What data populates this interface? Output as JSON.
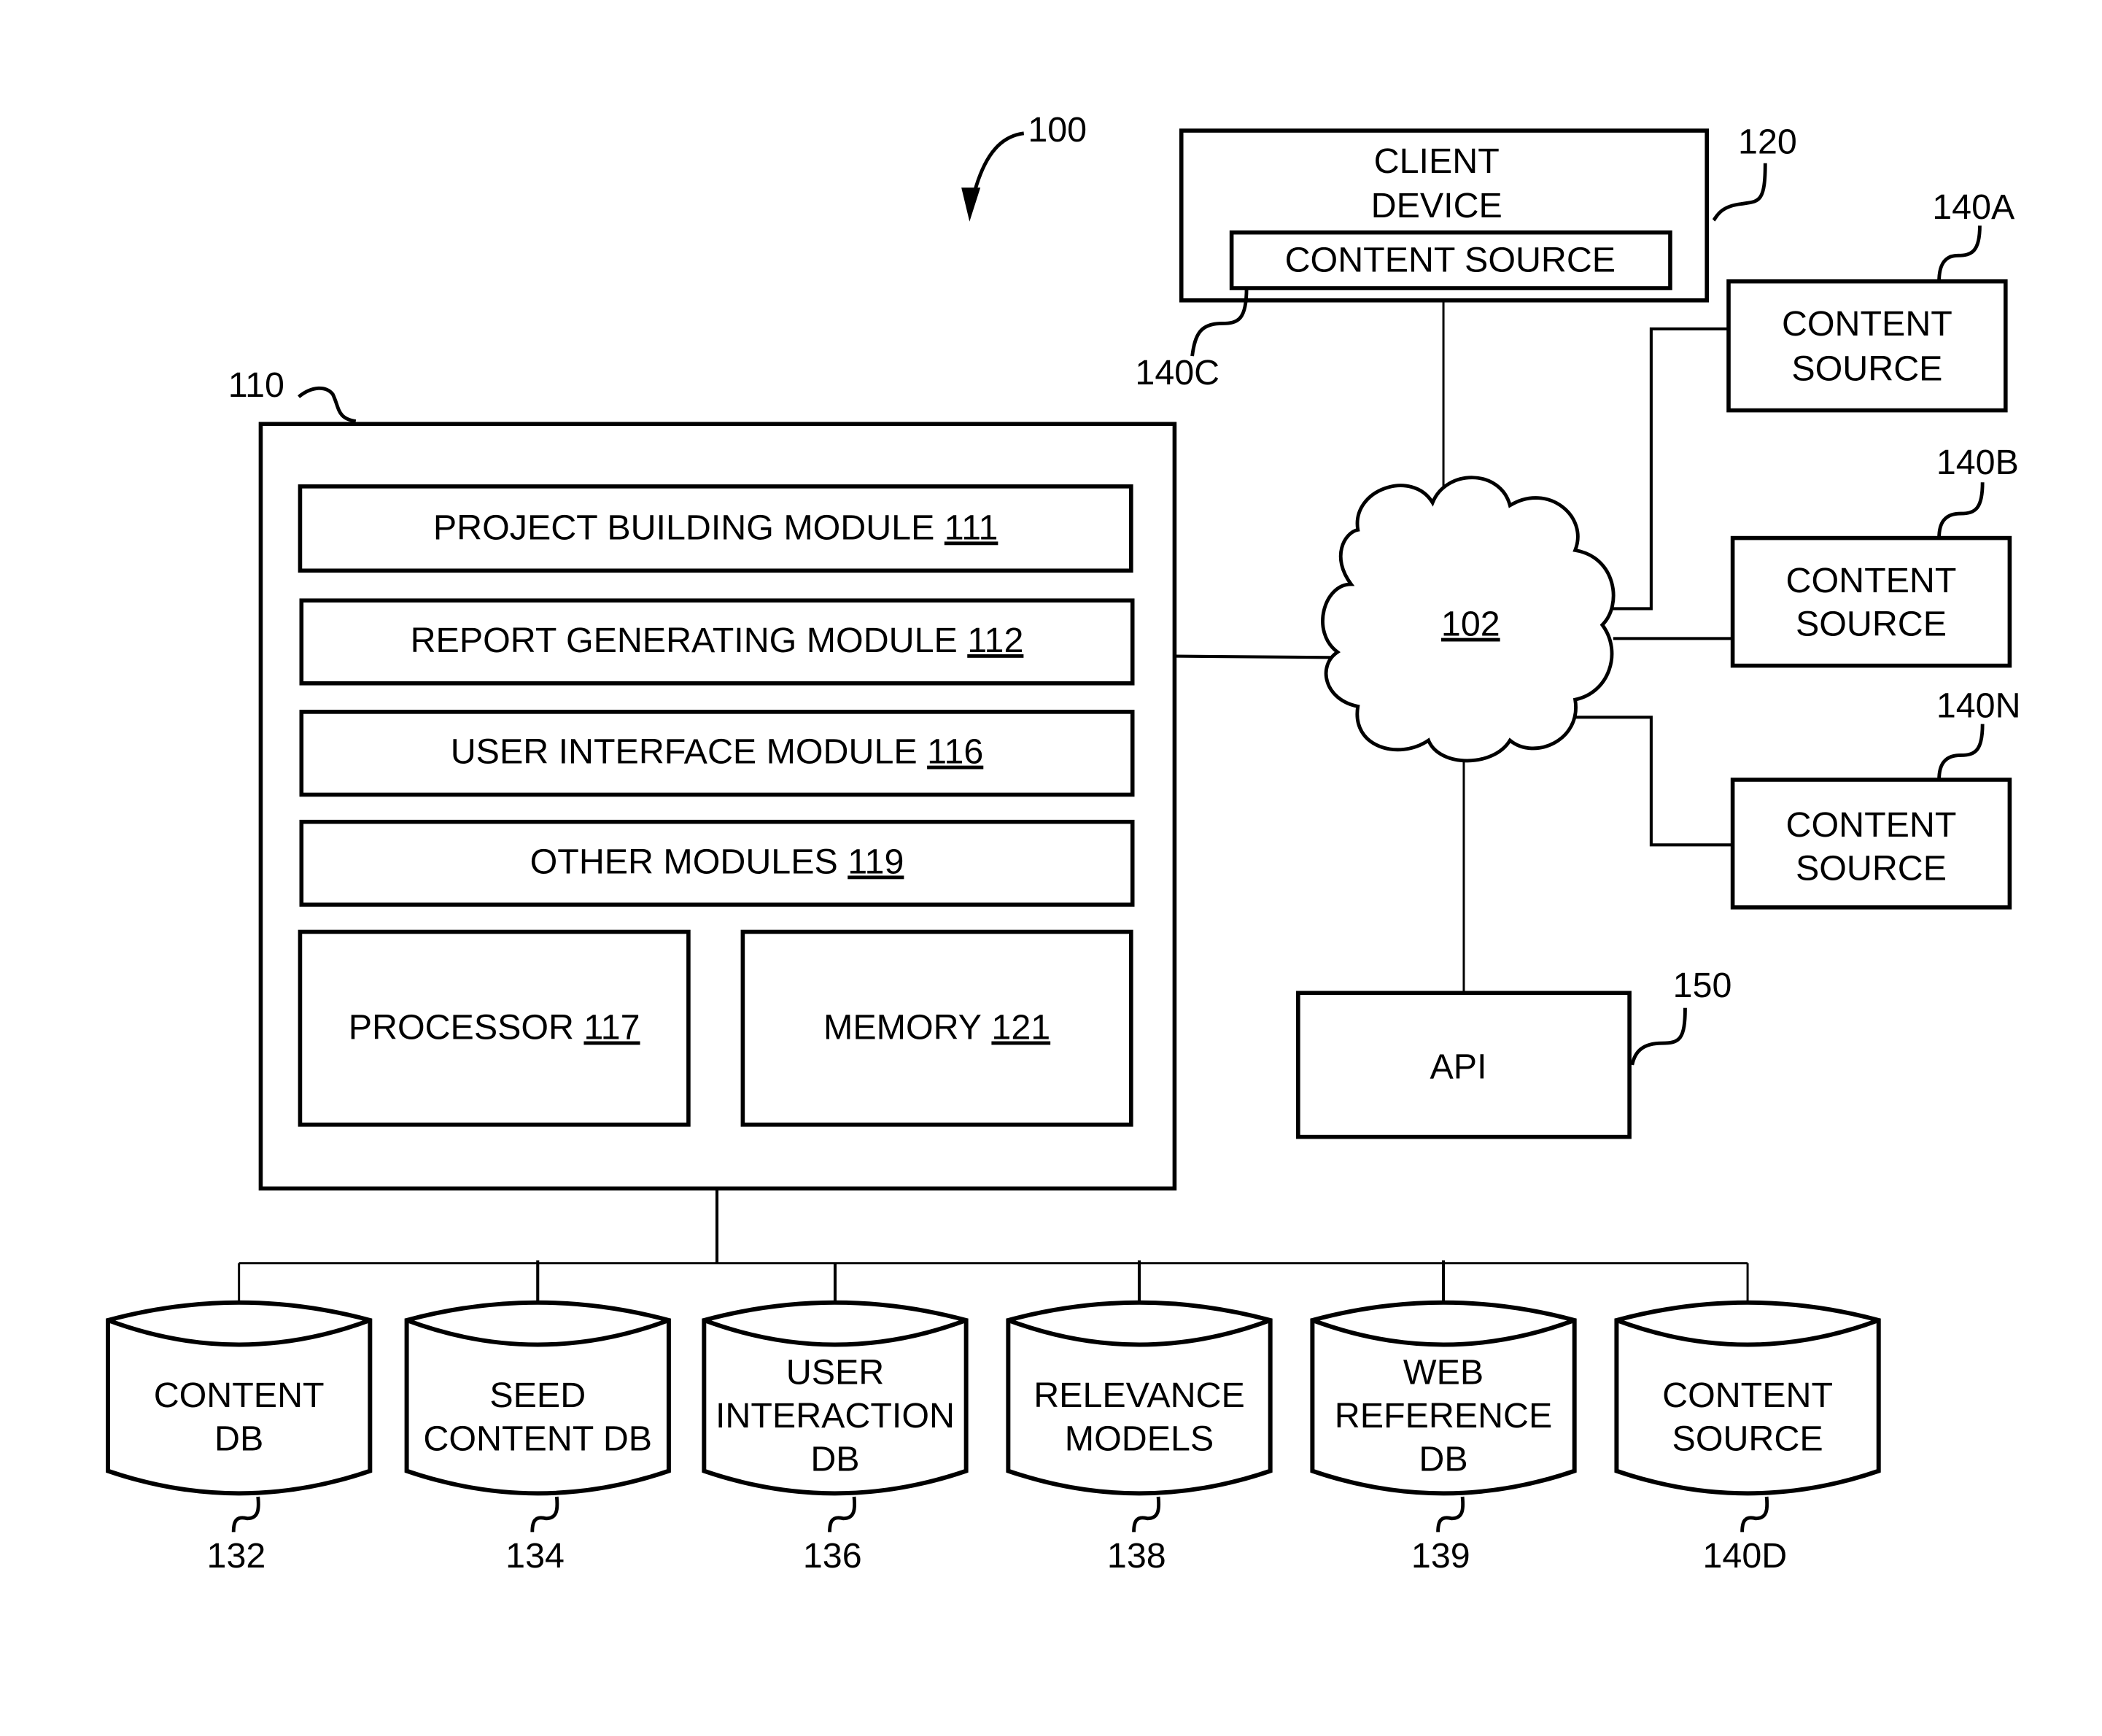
{
  "figure": {
    "ref": "100",
    "network": {
      "ref": "102"
    },
    "server": {
      "ref": "110",
      "modules": [
        {
          "label": "PROJECT BUILDING MODULE",
          "ref": "111"
        },
        {
          "label": "REPORT GENERATING MODULE",
          "ref": "112"
        },
        {
          "label": "USER INTERFACE MODULE",
          "ref": "116"
        },
        {
          "label": "OTHER MODULES",
          "ref": "119"
        }
      ],
      "processor": {
        "label": "PROCESSOR",
        "ref": "117"
      },
      "memory": {
        "label": "MEMORY",
        "ref": "121"
      }
    },
    "client_device": {
      "ref": "120",
      "line1": "CLIENT",
      "line2": "DEVICE",
      "content_source": {
        "label": "CONTENT SOURCE",
        "ref": "140C"
      }
    },
    "content_sources": [
      {
        "line1": "CONTENT",
        "line2": "SOURCE",
        "ref": "140A"
      },
      {
        "line1": "CONTENT",
        "line2": "SOURCE",
        "ref": "140B"
      },
      {
        "line1": "CONTENT",
        "line2": "SOURCE",
        "ref": "140N"
      }
    ],
    "api": {
      "label": "API",
      "ref": "150"
    },
    "databases": [
      {
        "lines": [
          "CONTENT",
          "DB"
        ],
        "ref": "132"
      },
      {
        "lines": [
          "SEED",
          "CONTENT DB"
        ],
        "ref": "134"
      },
      {
        "lines": [
          "USER",
          "INTERACTION",
          "DB"
        ],
        "ref": "136"
      },
      {
        "lines": [
          "RELEVANCE",
          "MODELS"
        ],
        "ref": "138"
      },
      {
        "lines": [
          "WEB",
          "REFERENCE",
          "DB"
        ],
        "ref": "139"
      },
      {
        "lines": [
          "CONTENT",
          "SOURCE"
        ],
        "ref": "140D"
      }
    ]
  }
}
